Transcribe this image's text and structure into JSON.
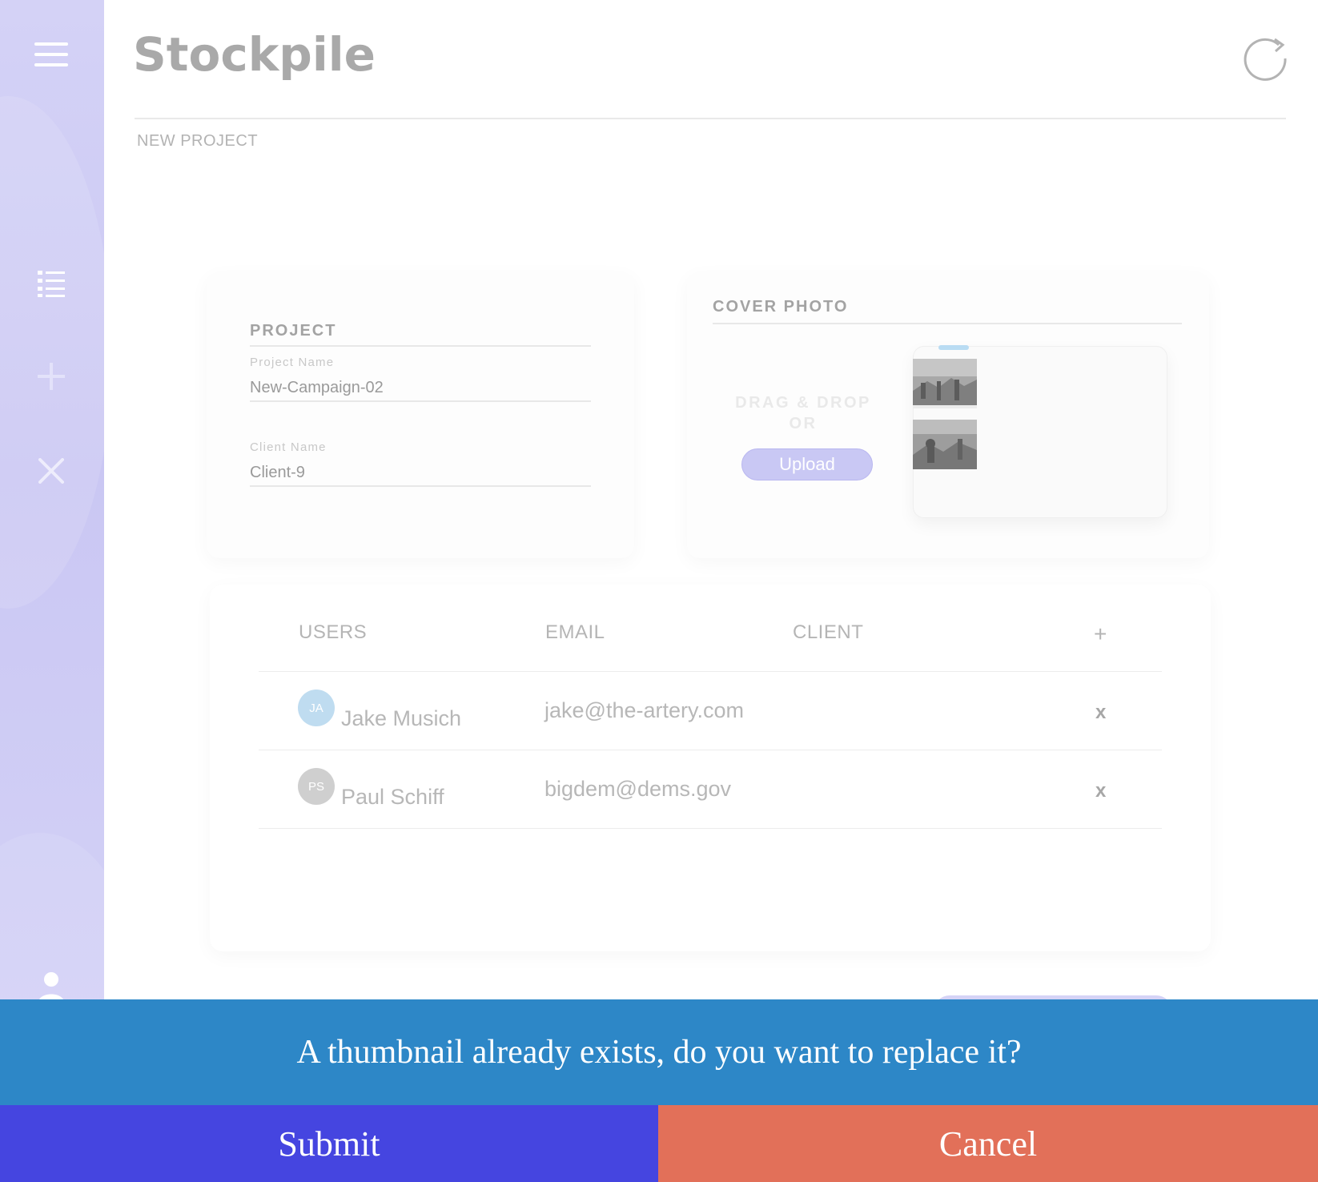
{
  "app": {
    "title": "Stockpile"
  },
  "breadcrumb": "NEW PROJECT",
  "sidebar": {
    "icons": [
      "menu-icon",
      "list-icon",
      "plus-icon",
      "close-icon",
      "user-icon"
    ]
  },
  "project": {
    "section_title": "PROJECT",
    "project_name_label": "Project Name",
    "project_name_value": "New-Campaign-02",
    "client_name_label": "Client Name",
    "client_name_value": "Client-9"
  },
  "cover_photo": {
    "section_title": "COVER PHOTO",
    "drag_drop": "DRAG & DROP",
    "or": "OR",
    "upload_label": "Upload"
  },
  "users_table": {
    "headers": [
      "USERS",
      "EMAIL",
      "CLIENT"
    ],
    "add_symbol": "+",
    "rows": [
      {
        "initials": "JA",
        "name": "Jake Musich",
        "email": "jake@the-artery.com",
        "remove": "x",
        "avatar_color": "#bfdcf0"
      },
      {
        "initials": "PS",
        "name": "Paul Schiff",
        "email": "bigdem@dems.gov",
        "remove": "x",
        "avatar_color": "#cfcfcf"
      }
    ]
  },
  "dialog": {
    "message": "A thumbnail already exists, do you want to replace it?",
    "submit_label": "Submit",
    "cancel_label": "Cancel"
  },
  "colors": {
    "sidebar": "#cac7f3",
    "dialog_bar": "#2d87c7",
    "submit": "#4545e0",
    "cancel": "#e27059",
    "upload": "#c9c8f4"
  }
}
